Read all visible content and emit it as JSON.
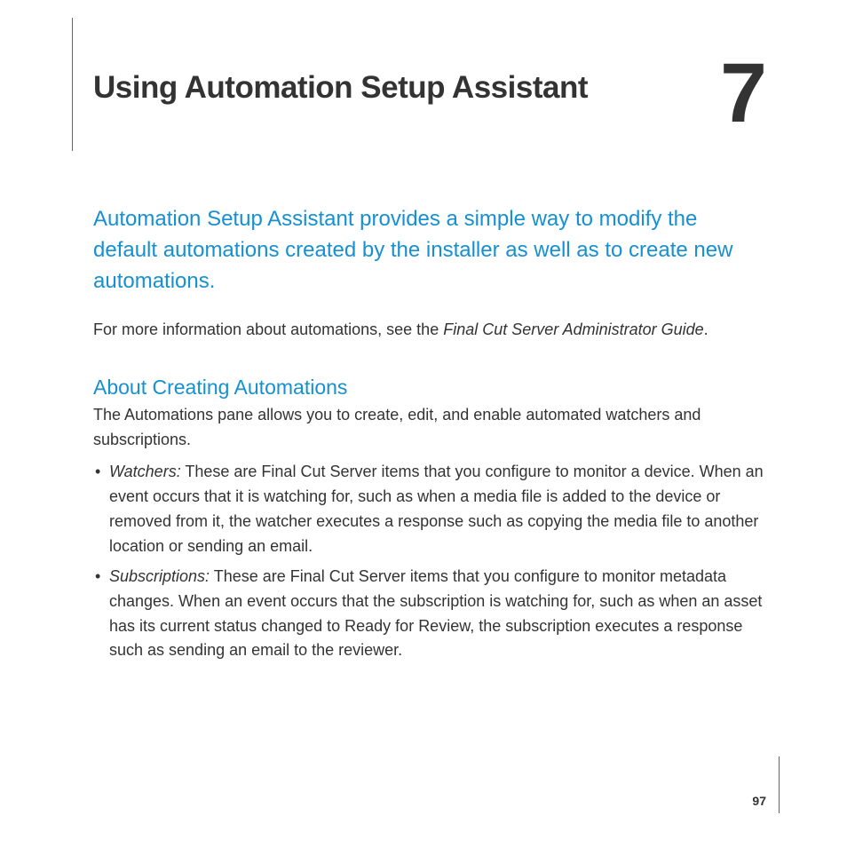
{
  "chapter": {
    "title": "Using Automation Setup Assistant",
    "number": "7"
  },
  "intro": "Automation Setup Assistant provides a simple way to modify the default automations created by the installer as well as to create new automations.",
  "more_info_prefix": "For more information about automations, see the ",
  "more_info_guide": "Final Cut Server Administrator Guide",
  "more_info_suffix": ".",
  "section": {
    "heading": "About Creating Automations",
    "body": "The Automations pane allows you to create, edit, and enable automated watchers and subscriptions.",
    "bullets": [
      {
        "label": "Watchers:",
        "text": "  These are Final Cut Server items that you configure to monitor a device. When an event occurs that it is watching for, such as when a media file is added to the device or removed from it, the watcher executes a response such as copying the media file to another location or sending an email."
      },
      {
        "label": "Subscriptions:",
        "text": "  These are Final Cut Server items that you configure to monitor metadata changes. When an event occurs that the subscription is watching for, such as when an asset has its current status changed to Ready for Review, the subscription executes a response such as sending an email to the reviewer."
      }
    ]
  },
  "page_number": "97"
}
